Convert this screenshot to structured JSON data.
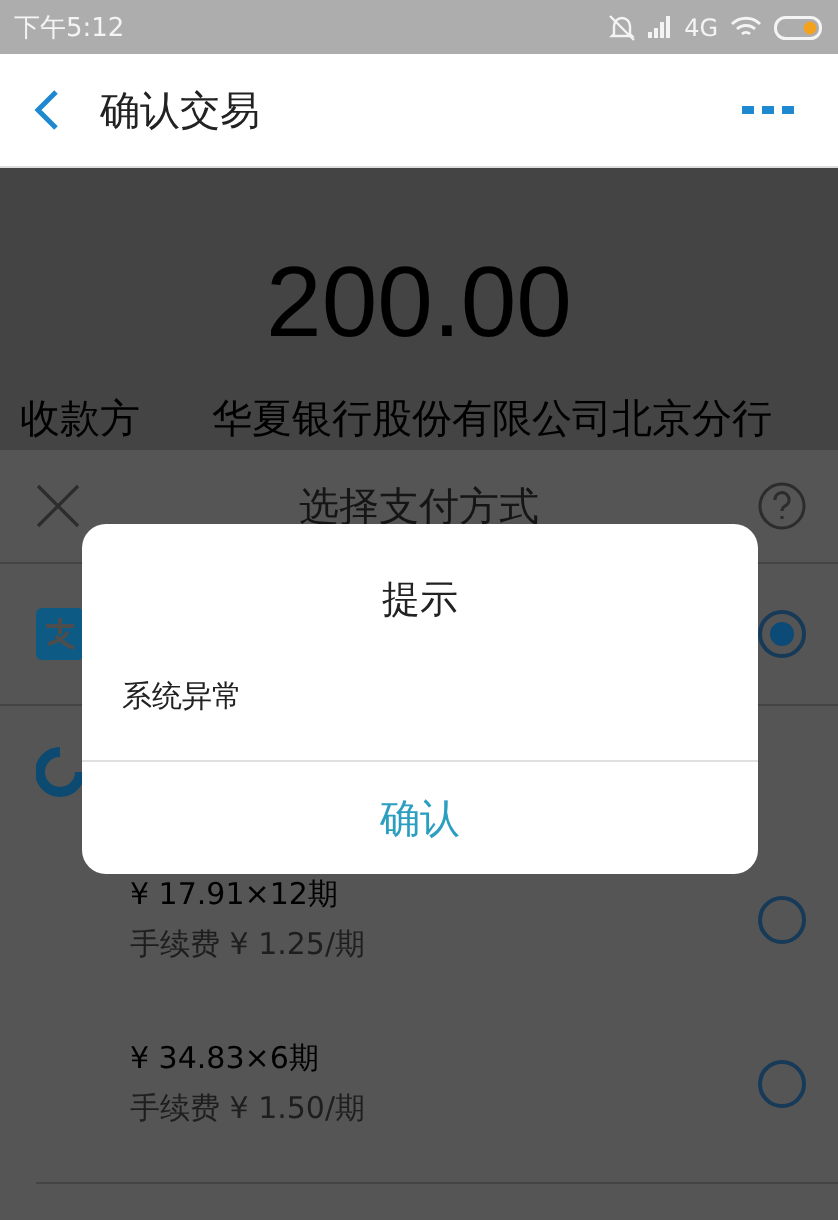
{
  "status_bar": {
    "time": "下午5:12",
    "network": "4G"
  },
  "header": {
    "title": "确认交易"
  },
  "transaction": {
    "amount": "200.00",
    "payee_label": "收款方",
    "payee": "华夏银行股份有限公司北京分行"
  },
  "payment_sheet": {
    "title": "选择支付方式",
    "methods": [
      {
        "kind": "balance",
        "selected": true
      },
      {
        "kind": "huabei"
      }
    ],
    "installments": [
      {
        "amount": "¥ 17.91×12期",
        "fee": "手续费 ¥ 1.25/期",
        "selected": false
      },
      {
        "amount": "¥ 34.83×6期",
        "fee": "手续费 ¥ 1.50/期",
        "selected": false
      }
    ]
  },
  "dialog": {
    "title": "提示",
    "message": "系统异常",
    "button": "确认"
  }
}
